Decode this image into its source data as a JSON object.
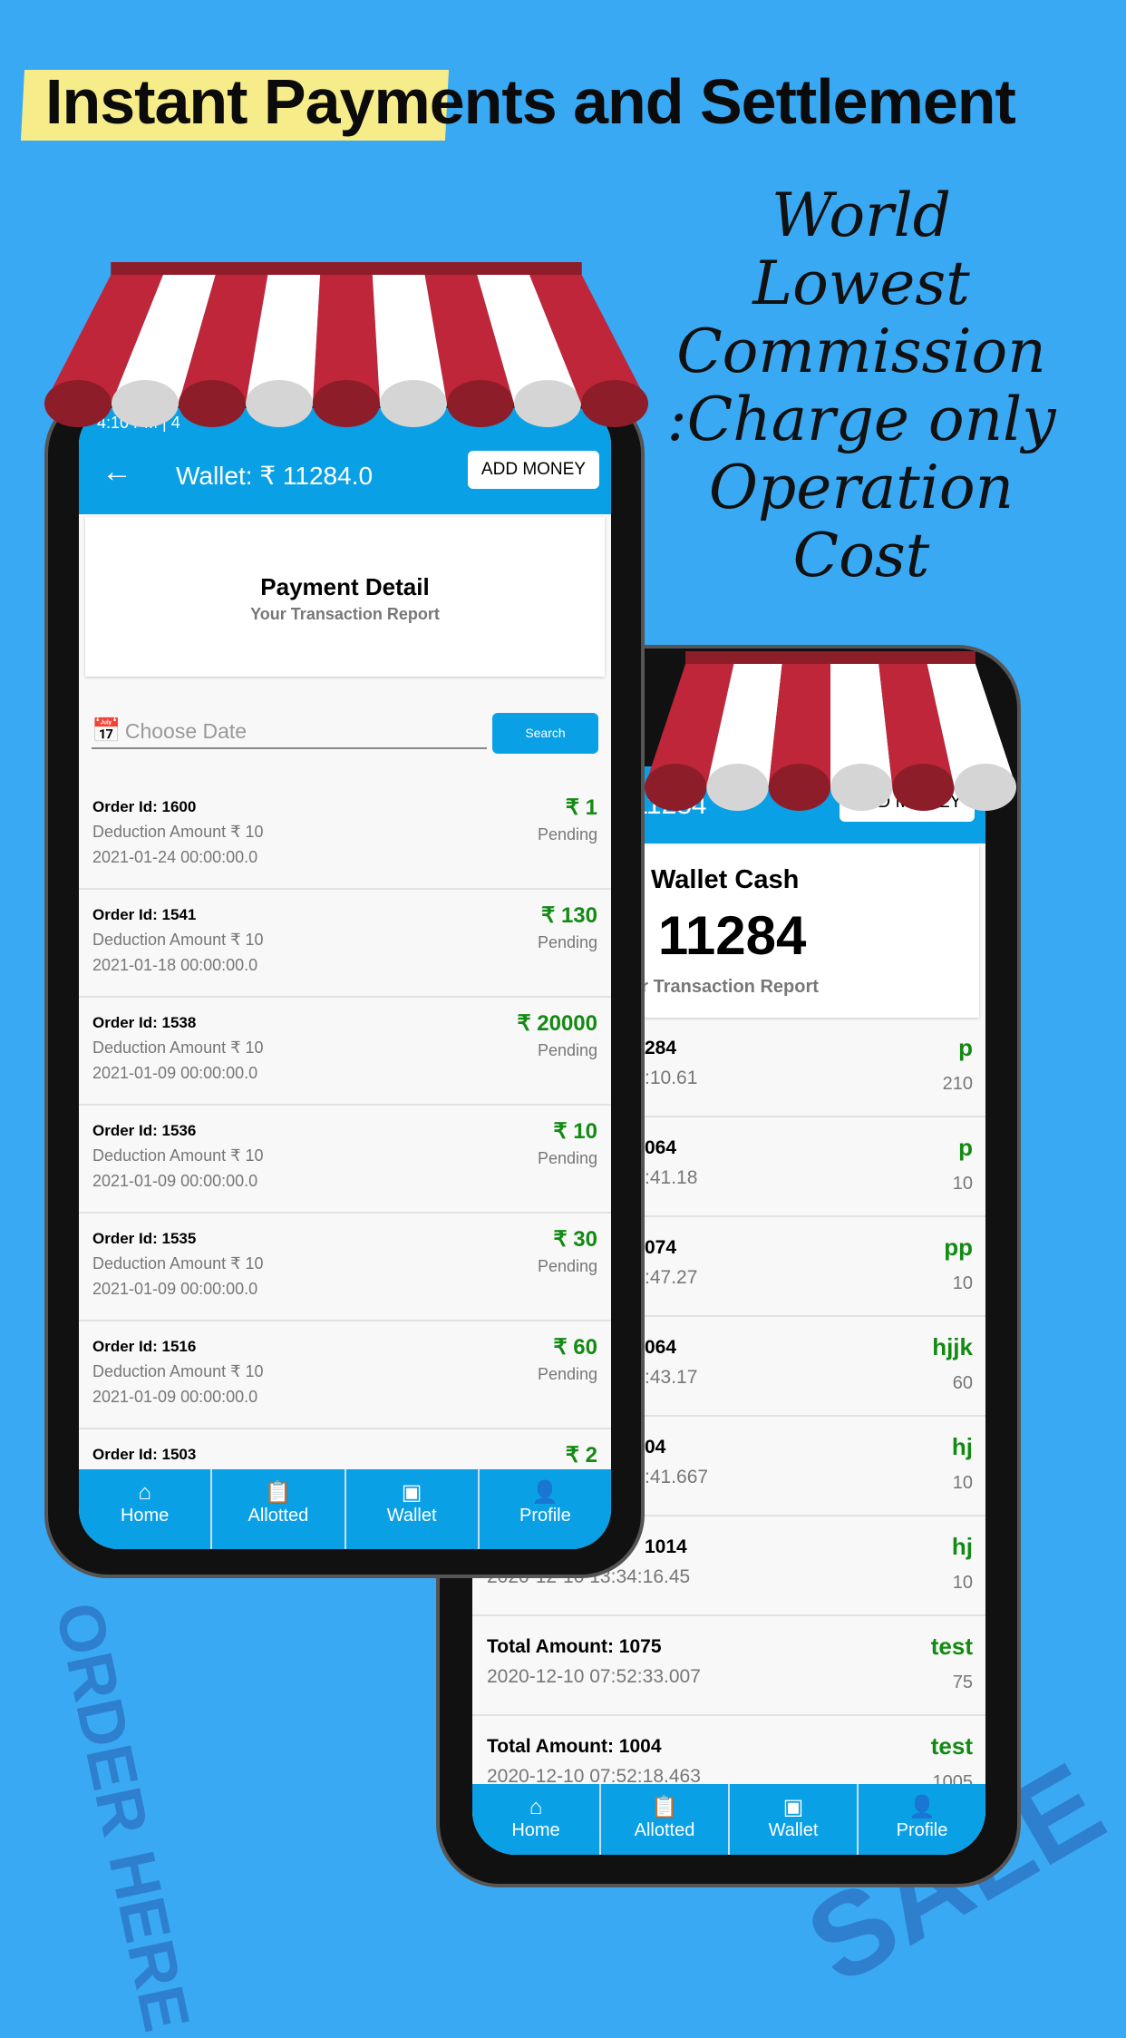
{
  "headline": "Instant Payments and Settlement",
  "tagline": [
    "World",
    "Lowest",
    "Commission",
    ":Charge only",
    "Operation",
    "Cost"
  ],
  "decor": {
    "stamp1": "ORDER HERE",
    "stamp2": "SALE"
  },
  "colors": {
    "background": "#3aa9f4",
    "app_blue": "#0aa0e6",
    "amount_green": "#138a13",
    "awning_red": "#c0263a"
  },
  "phone1": {
    "status_time": "4:10 PM | 4",
    "header": {
      "back_icon": "arrow-left-icon",
      "title": "Wallet: ₹ 11284.0",
      "add_money": "ADD MONEY"
    },
    "card": {
      "title": "Payment Detail",
      "subtitle": "Your Transaction Report"
    },
    "date_placeholder": "Choose Date",
    "search": "Search",
    "rows": [
      {
        "order": "Order Id: 1600",
        "deduction": "Deduction Amount  ₹ 10",
        "date": "2021-01-24 00:00:00.0",
        "amount": "₹ 1",
        "status": "Pending"
      },
      {
        "order": "Order Id: 1541",
        "deduction": "Deduction Amount  ₹ 10",
        "date": "2021-01-18 00:00:00.0",
        "amount": "₹ 130",
        "status": "Pending"
      },
      {
        "order": "Order Id: 1538",
        "deduction": "Deduction Amount  ₹ 10",
        "date": "2021-01-09 00:00:00.0",
        "amount": "₹ 20000",
        "status": "Pending"
      },
      {
        "order": "Order Id: 1536",
        "deduction": "Deduction Amount  ₹ 10",
        "date": "2021-01-09 00:00:00.0",
        "amount": "₹ 10",
        "status": "Pending"
      },
      {
        "order": "Order Id: 1535",
        "deduction": "Deduction Amount  ₹ 10",
        "date": "2021-01-09 00:00:00.0",
        "amount": "₹ 30",
        "status": "Pending"
      },
      {
        "order": "Order Id: 1516",
        "deduction": "Deduction Amount  ₹ 10",
        "date": "2021-01-09 00:00:00.0",
        "amount": "₹ 60",
        "status": "Pending"
      },
      {
        "order": "Order Id: 1503",
        "deduction": "",
        "date": "",
        "amount": "₹ 2",
        "status": ""
      }
    ],
    "nav": [
      {
        "label": "Home",
        "icon": "home-icon"
      },
      {
        "label": "Allotted",
        "icon": "clipboard-icon"
      },
      {
        "label": "Wallet",
        "icon": "wallet-icon"
      },
      {
        "label": "Profile",
        "icon": "person-icon"
      }
    ]
  },
  "phone2": {
    "header": {
      "title": "₹ 11284",
      "add_money": "ADD MONEY"
    },
    "card": {
      "title": "Wallet Cash",
      "amount": "₹ 11284",
      "subtitle": "Your Transaction Report"
    },
    "rows": [
      {
        "title": "284",
        "date": ":10.61",
        "label": "p",
        "value": "210"
      },
      {
        "title": "064",
        "date": ":41.18",
        "label": "p",
        "value": "10"
      },
      {
        "title": "074",
        "date": ":47.27",
        "label": "pp",
        "value": "10"
      },
      {
        "title": "064",
        "date": ":43.17",
        "label": "hjjk",
        "value": "60"
      },
      {
        "title": "04",
        "date": ":41.667",
        "label": "hj",
        "value": "10"
      },
      {
        "title": "1014",
        "date": "2020-12-10 13:34:16.45",
        "label": "hj",
        "value": "10"
      },
      {
        "title": "Total Amount: 1075",
        "date": "2020-12-10 07:52:33.007",
        "label": "test",
        "value": "75"
      },
      {
        "title": "Total Amount: 1004",
        "date": "2020-12-10 07:52:18.463",
        "label": "test",
        "value": "1005"
      }
    ],
    "nav": [
      {
        "label": "Home",
        "icon": "home-icon"
      },
      {
        "label": "Allotted",
        "icon": "clipboard-icon"
      },
      {
        "label": "Wallet",
        "icon": "wallet-icon"
      },
      {
        "label": "Profile",
        "icon": "person-icon"
      }
    ]
  }
}
